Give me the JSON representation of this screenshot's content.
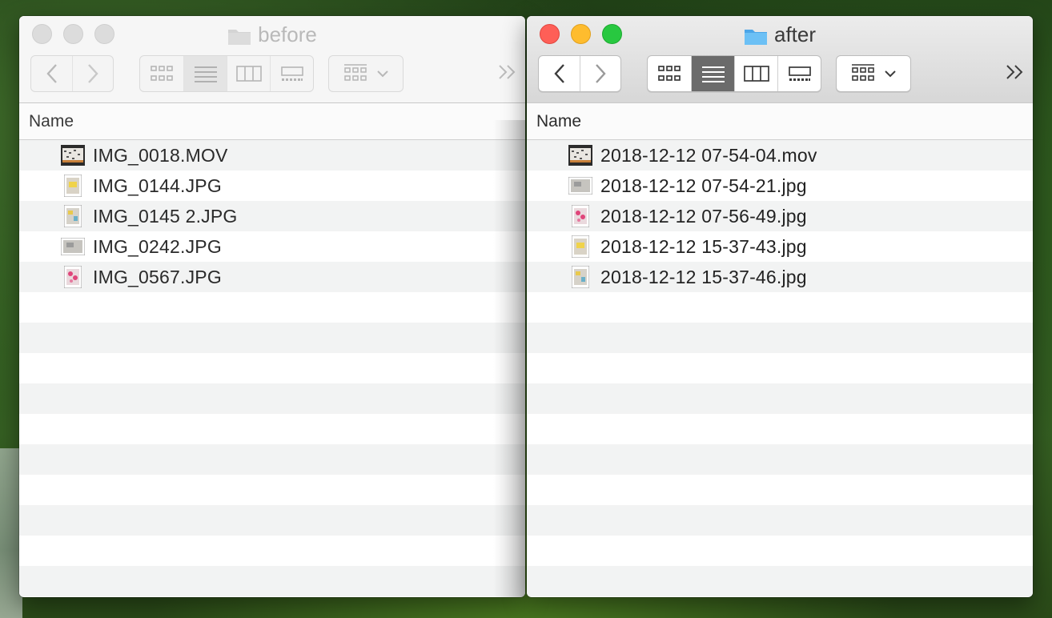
{
  "colors": {
    "accent_folder": "#5ab4f2",
    "inactive_text": "#b9b9b9",
    "close": "#fe5f57",
    "minimize": "#febc2e",
    "maximize": "#28c840",
    "active_view": "#6b6b6b"
  },
  "windows": [
    {
      "title": "before",
      "active": false,
      "column_header": "Name",
      "files": [
        {
          "name": "IMG_0018.MOV",
          "icon": "video-thumbnail-icon"
        },
        {
          "name": "IMG_0144.JPG",
          "icon": "image-thumbnail-icon"
        },
        {
          "name": "IMG_0145 2.JPG",
          "icon": "image-thumbnail-icon"
        },
        {
          "name": "IMG_0242.JPG",
          "icon": "image-thumbnail-icon"
        },
        {
          "name": "IMG_0567.JPG",
          "icon": "image-thumbnail-icon"
        }
      ]
    },
    {
      "title": "after",
      "active": true,
      "column_header": "Name",
      "files": [
        {
          "name": "2018-12-12 07-54-04.mov",
          "icon": "video-thumbnail-icon"
        },
        {
          "name": "2018-12-12 07-54-21.jpg",
          "icon": "image-thumbnail-icon"
        },
        {
          "name": "2018-12-12 07-56-49.jpg",
          "icon": "image-thumbnail-icon"
        },
        {
          "name": "2018-12-12 15-37-43.jpg",
          "icon": "image-thumbnail-icon"
        },
        {
          "name": "2018-12-12 15-37-46.jpg",
          "icon": "image-thumbnail-icon"
        }
      ]
    }
  ],
  "toolbar": {
    "view_modes": [
      "icon-view",
      "list-view",
      "column-view",
      "gallery-view"
    ],
    "selected_view": "list-view"
  }
}
